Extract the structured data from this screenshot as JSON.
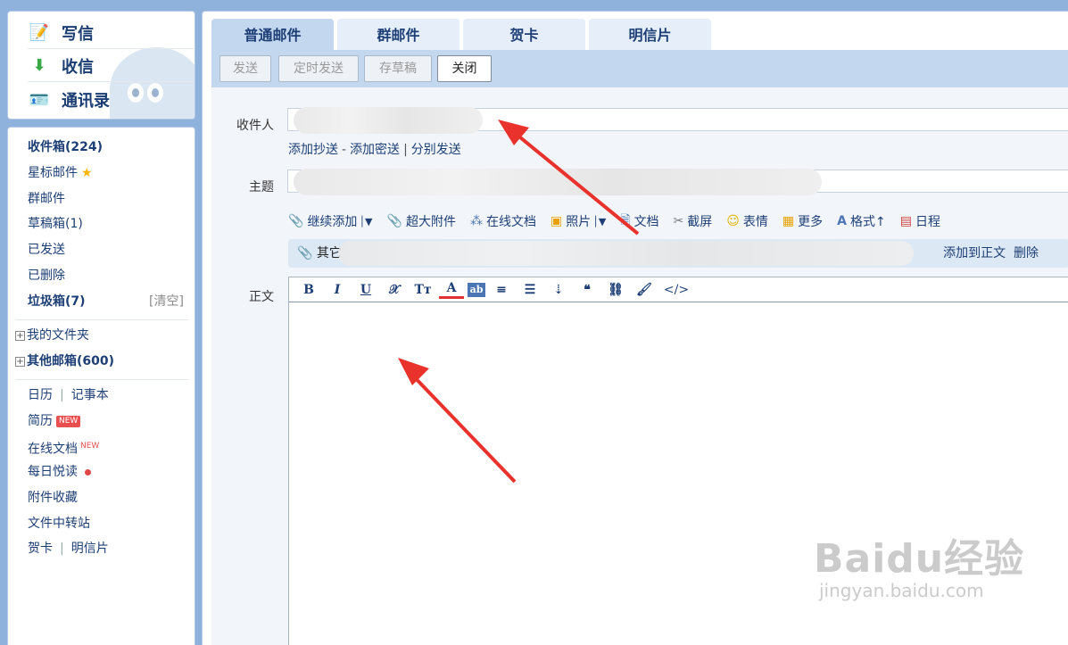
{
  "quick_actions": [
    {
      "label": "写信",
      "icon": "compose-icon"
    },
    {
      "label": "收信",
      "icon": "inbox-download-icon"
    },
    {
      "label": "通讯录",
      "icon": "contacts-icon"
    }
  ],
  "nav": {
    "inbox": "收件箱(224)",
    "starred": "星标邮件",
    "group": "群邮件",
    "drafts": "草稿箱(1)",
    "sent": "已发送",
    "deleted": "已删除",
    "spam": "垃圾箱(7)",
    "spam_clear": "[清空]",
    "my_folders": "我的文件夹",
    "other_mailboxes": "其他邮箱(600)",
    "calendar": "日历",
    "notepad": "记事本",
    "resume": "简历",
    "resume_badge": "NEW",
    "online_docs": "在线文档",
    "online_docs_badge": "NEW",
    "daily_read": "每日悦读",
    "attachment_favs": "附件收藏",
    "file_transfer": "文件中转站",
    "greeting_card": "贺卡",
    "postcard": "明信片",
    "separator": "|"
  },
  "tabs": [
    "普通邮件",
    "群邮件",
    "贺卡",
    "明信片"
  ],
  "toolbar": {
    "send": "发送",
    "scheduled_send": "定时发送",
    "save_draft": "存草稿",
    "close": "关闭"
  },
  "compose": {
    "to_label": "收件人",
    "add_cc": "添加抄送",
    "add_bcc": "添加密送",
    "separate_send": "分别发送",
    "dash": "-",
    "bar": "|",
    "subject_label": "主题",
    "body_label": "正文"
  },
  "attach_tools": [
    {
      "label": "继续添加",
      "icon": "paperclip-icon",
      "dropdown": true
    },
    {
      "label": "超大附件",
      "icon": "large-attachment-icon"
    },
    {
      "label": "在线文档",
      "icon": "online-doc-icon"
    },
    {
      "label": "照片",
      "icon": "photo-icon",
      "dropdown": true
    },
    {
      "label": "文档",
      "icon": "document-icon"
    },
    {
      "label": "截屏",
      "icon": "screenshot-icon"
    },
    {
      "label": "表情",
      "icon": "emoji-icon"
    },
    {
      "label": "更多",
      "icon": "more-grid-icon"
    },
    {
      "label": "格式↑",
      "icon": "format-icon"
    },
    {
      "label": "日程",
      "icon": "calendar-icon"
    }
  ],
  "attachment_bar": {
    "name": "其它",
    "add_to_body": "添加到正文",
    "delete": "删除"
  },
  "editor_tools": [
    "B",
    "I",
    "U",
    "𝒳",
    "Tт",
    "A",
    "ab",
    "≡",
    "☰",
    "⇣",
    "❝",
    "⛓",
    "🖌",
    "</>"
  ],
  "watermark": {
    "brand": "Baidu经验",
    "url": "jingyan.baidu.com"
  },
  "colors": {
    "accent": "#1d3f75",
    "arrow": "#e8322b",
    "panel": "#c3d7ef",
    "bg": "#8fb2dc"
  }
}
